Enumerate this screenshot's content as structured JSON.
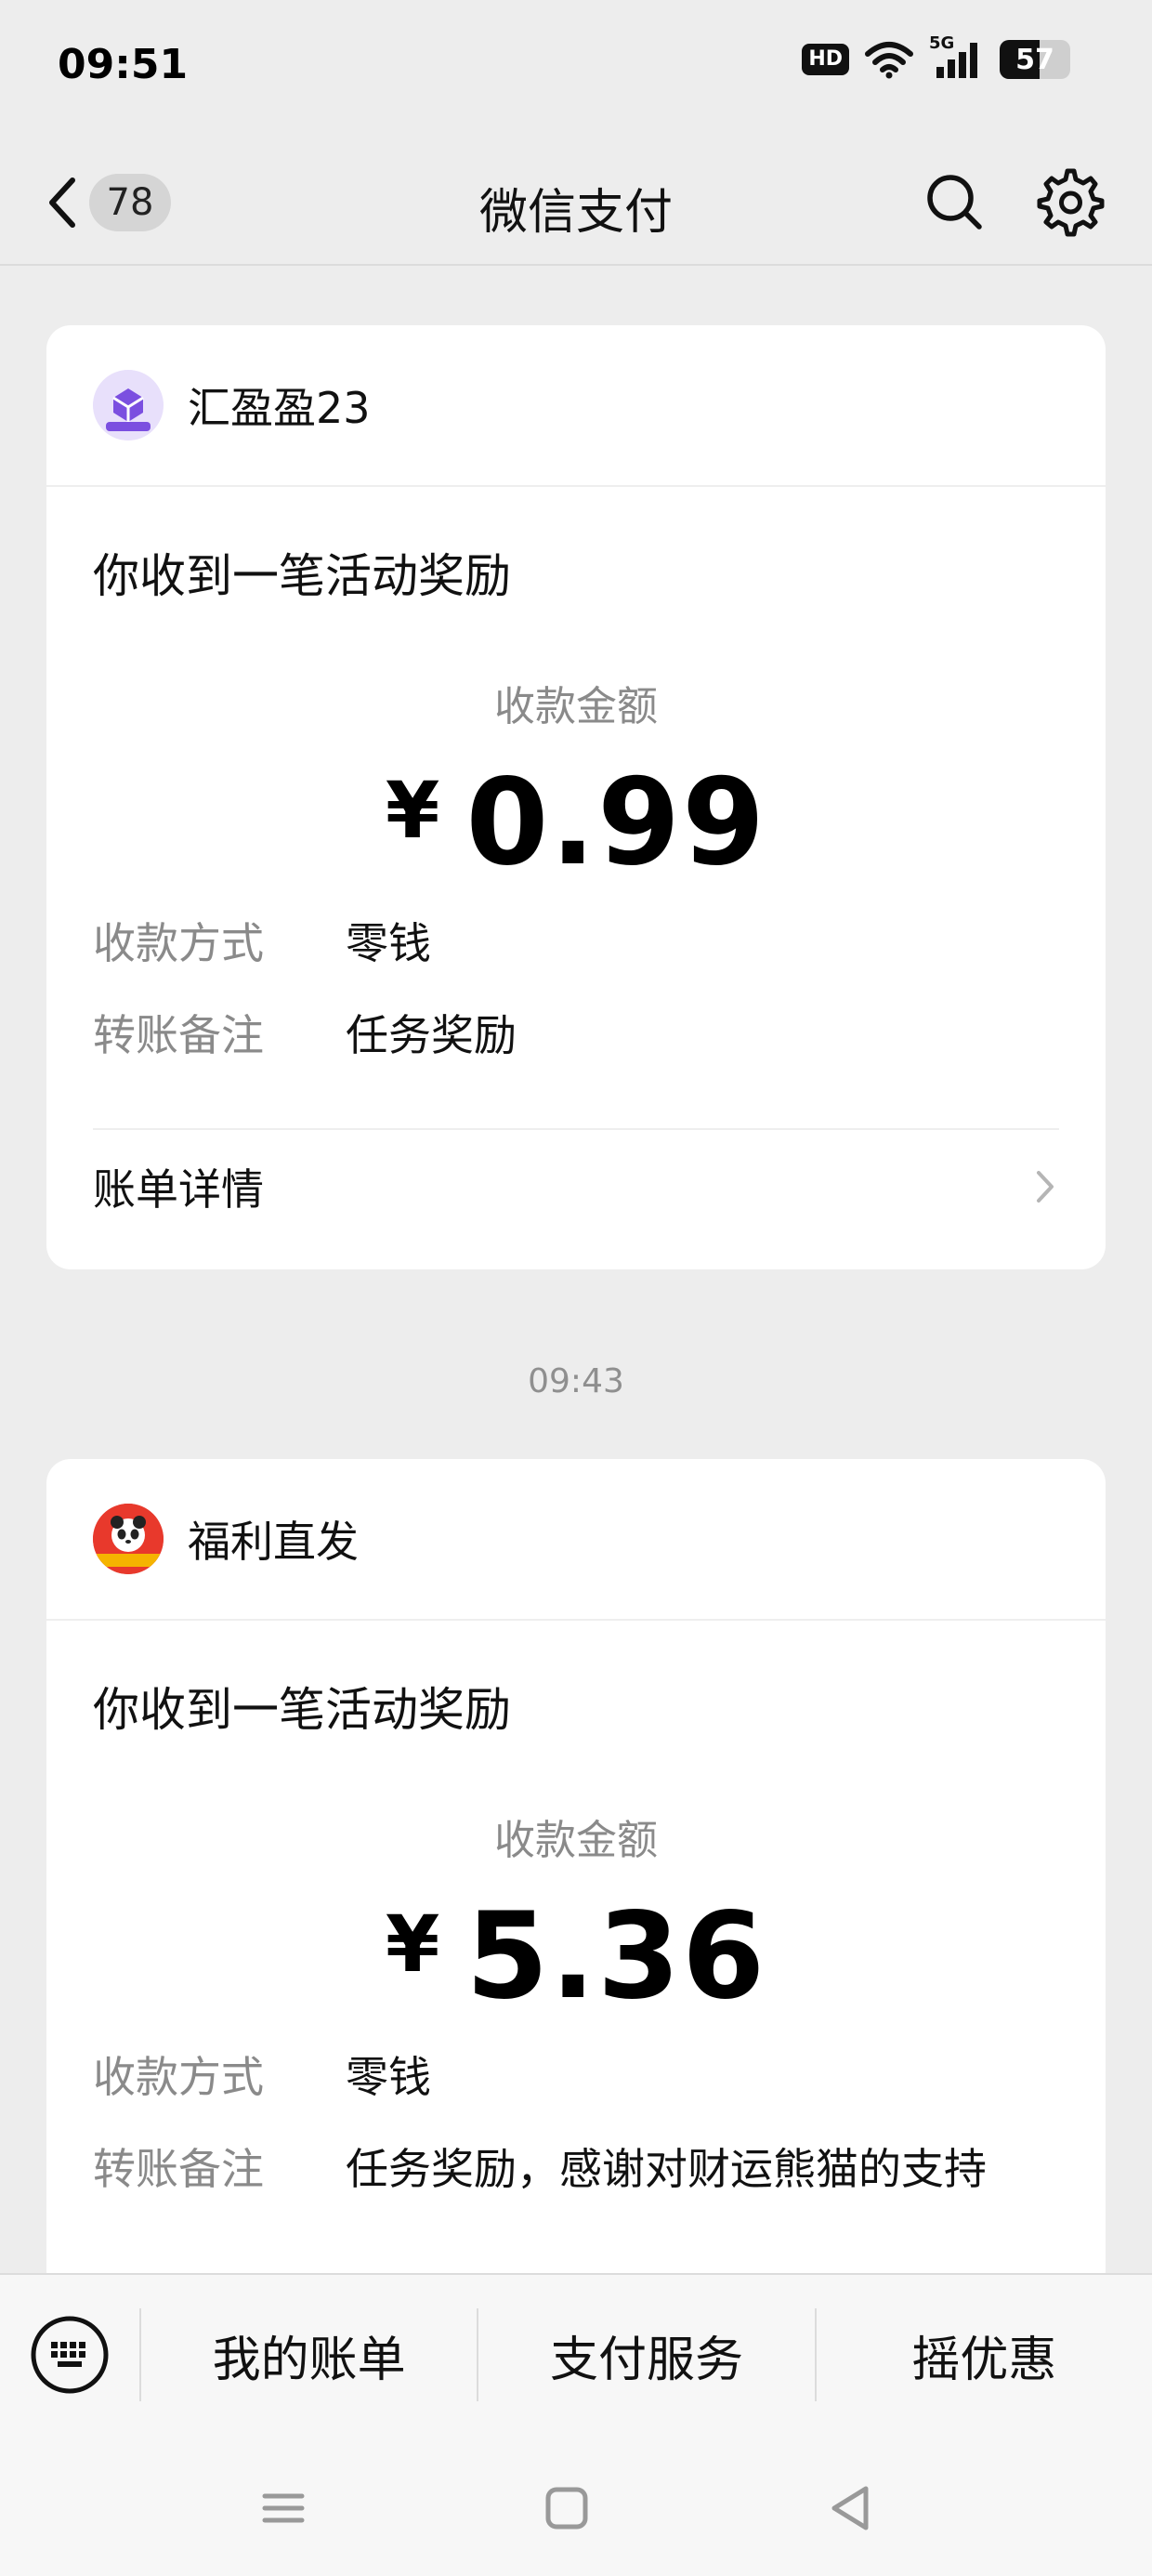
{
  "status_bar": {
    "time": "09:51",
    "hd_label": "HD",
    "network_label": "5G",
    "battery_level": "57",
    "battery_percent": 57
  },
  "header": {
    "unread_count": "78",
    "title": "微信支付"
  },
  "messages": [
    {
      "sender": "汇盈盈23",
      "title": "你收到一笔活动奖励",
      "amount_label": "收款金额",
      "currency": "¥",
      "amount": "0.99",
      "details": [
        {
          "label": "收款方式",
          "value": "零钱"
        },
        {
          "label": "转账备注",
          "value": "任务奖励"
        }
      ],
      "link_label": "账单详情"
    },
    {
      "sender": "福利直发",
      "title": "你收到一笔活动奖励",
      "amount_label": "收款金额",
      "currency": "¥",
      "amount": "5.36",
      "details": [
        {
          "label": "收款方式",
          "value": "零钱"
        },
        {
          "label": "转账备注",
          "value": "任务奖励，感谢对财运熊猫的支持"
        }
      ]
    }
  ],
  "separator_time": "09:43",
  "bottom_menu": {
    "items": [
      "我的账单",
      "支付服务",
      "摇优惠"
    ]
  },
  "colors": {
    "background": "#ededed",
    "card": "#ffffff",
    "secondary_text": "#8a8a8a"
  }
}
